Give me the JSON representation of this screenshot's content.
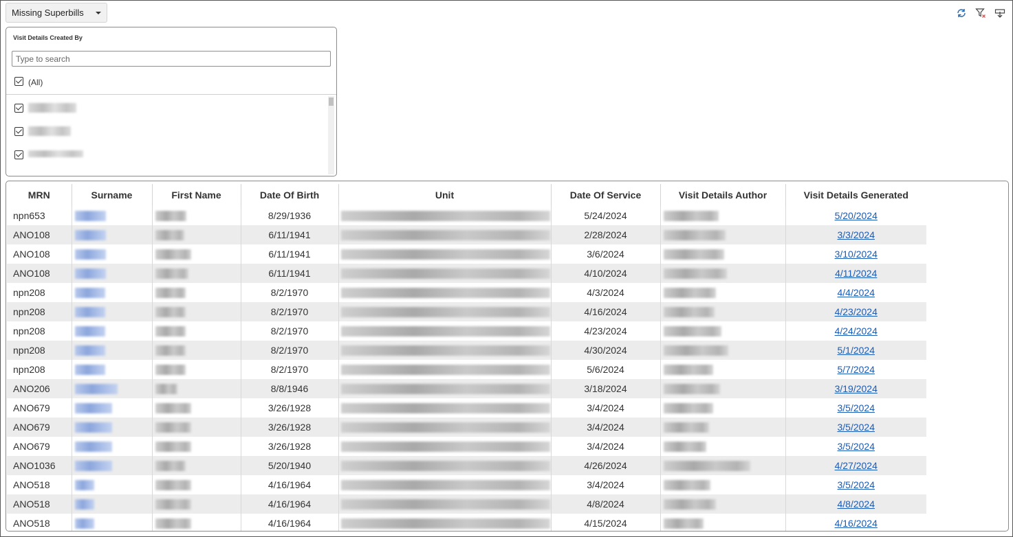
{
  "report_selector": {
    "label": "Missing Superbills"
  },
  "toolbar": {
    "icons": [
      "refresh-icon",
      "clear-filter-icon",
      "export-icon"
    ]
  },
  "filter": {
    "title": "Visit Details Created By",
    "search_placeholder": "Type to search",
    "all_label": "(All)",
    "all_checked": true,
    "items_checked": [
      true,
      true,
      true
    ]
  },
  "table": {
    "columns": [
      "MRN",
      "Surname",
      "First Name",
      "Date Of Birth",
      "Unit",
      "Date Of Service",
      "Visit Details Author",
      "Visit Details Generated"
    ],
    "rows": [
      {
        "mrn": "npn653",
        "dob": "8/29/1936",
        "dos": "5/24/2024",
        "generated": "5/20/2024"
      },
      {
        "mrn": "ANO108",
        "dob": "6/11/1941",
        "dos": "2/28/2024",
        "generated": "3/3/2024"
      },
      {
        "mrn": "ANO108",
        "dob": "6/11/1941",
        "dos": "3/6/2024",
        "generated": "3/10/2024"
      },
      {
        "mrn": "ANO108",
        "dob": "6/11/1941",
        "dos": "4/10/2024",
        "generated": "4/11/2024"
      },
      {
        "mrn": "npn208",
        "dob": "8/2/1970",
        "dos": "4/3/2024",
        "generated": "4/4/2024"
      },
      {
        "mrn": "npn208",
        "dob": "8/2/1970",
        "dos": "4/16/2024",
        "generated": "4/23/2024"
      },
      {
        "mrn": "npn208",
        "dob": "8/2/1970",
        "dos": "4/23/2024",
        "generated": "4/24/2024"
      },
      {
        "mrn": "npn208",
        "dob": "8/2/1970",
        "dos": "4/30/2024",
        "generated": "5/1/2024"
      },
      {
        "mrn": "npn208",
        "dob": "8/2/1970",
        "dos": "5/6/2024",
        "generated": "5/7/2024"
      },
      {
        "mrn": "ANO206",
        "dob": "8/8/1946",
        "dos": "3/18/2024",
        "generated": "3/19/2024"
      },
      {
        "mrn": "ANO679",
        "dob": "3/26/1928",
        "dos": "3/4/2024",
        "generated": "3/5/2024"
      },
      {
        "mrn": "ANO679",
        "dob": "3/26/1928",
        "dos": "3/4/2024",
        "generated": "3/5/2024"
      },
      {
        "mrn": "ANO679",
        "dob": "3/26/1928",
        "dos": "3/4/2024",
        "generated": "3/5/2024"
      },
      {
        "mrn": "ANO1036",
        "dob": "5/20/1940",
        "dos": "4/26/2024",
        "generated": "4/27/2024"
      },
      {
        "mrn": "ANO518",
        "dob": "4/16/1964",
        "dos": "3/4/2024",
        "generated": "3/5/2024"
      },
      {
        "mrn": "ANO518",
        "dob": "4/16/1964",
        "dos": "4/8/2024",
        "generated": "4/8/2024"
      },
      {
        "mrn": "ANO518",
        "dob": "4/16/1964",
        "dos": "4/15/2024",
        "generated": "4/16/2024"
      }
    ]
  }
}
